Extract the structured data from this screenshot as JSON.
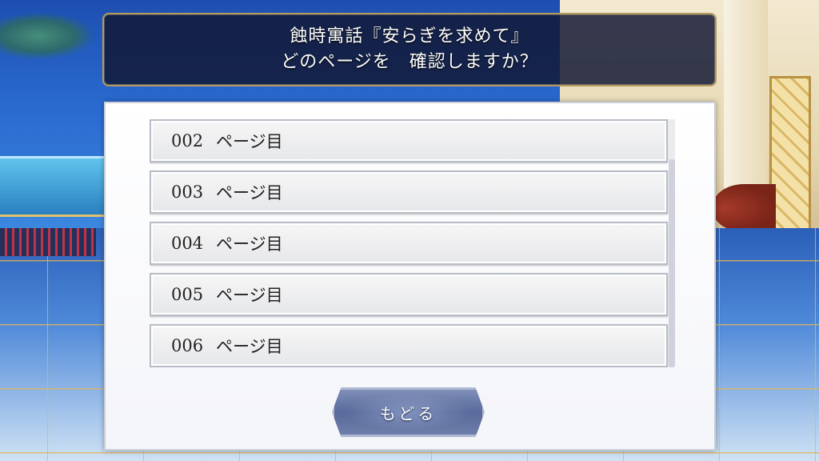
{
  "banner": {
    "title": "蝕時寓話『安らぎを求めて』",
    "prompt": "どのページを　確認しますか？"
  },
  "page_list": [
    {
      "number": "002",
      "suffix": "ページ目"
    },
    {
      "number": "003",
      "suffix": "ページ目"
    },
    {
      "number": "004",
      "suffix": "ページ目"
    },
    {
      "number": "005",
      "suffix": "ページ目"
    },
    {
      "number": "006",
      "suffix": "ページ目"
    }
  ],
  "back_button": {
    "label": "もどる"
  },
  "colors": {
    "banner_bg": "#121834",
    "banner_border": "#b59a5c",
    "panel_bg": "#ffffff",
    "item_bg": "#e6e7ea",
    "button_bg": "#59699a"
  }
}
